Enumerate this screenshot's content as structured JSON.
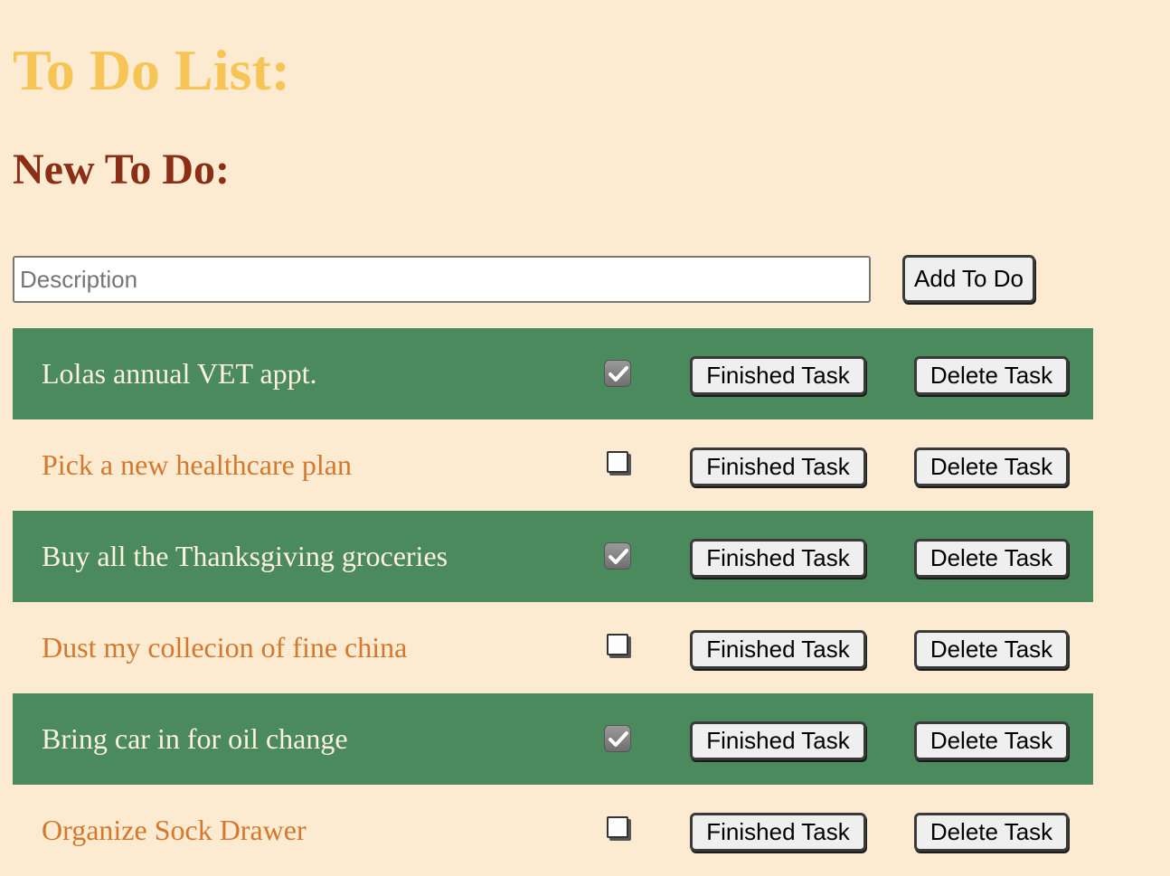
{
  "header": {
    "title": "To Do List:",
    "subtitle": "New To Do:"
  },
  "form": {
    "description_placeholder": "Description",
    "description_value": "",
    "add_label": "Add To Do"
  },
  "todos": [
    {
      "text": "Lolas annual VET appt.",
      "done": true,
      "finish_label": "Finished Task",
      "delete_label": "Delete Task"
    },
    {
      "text": "Pick a new healthcare plan",
      "done": false,
      "finish_label": "Finished Task",
      "delete_label": "Delete Task"
    },
    {
      "text": "Buy all the Thanksgiving groceries",
      "done": true,
      "finish_label": "Finished Task",
      "delete_label": "Delete Task"
    },
    {
      "text": "Dust my collecion of fine china",
      "done": false,
      "finish_label": "Finished Task",
      "delete_label": "Delete Task"
    },
    {
      "text": "Bring car in for oil change",
      "done": true,
      "finish_label": "Finished Task",
      "delete_label": "Delete Task"
    },
    {
      "text": "Organize Sock Drawer",
      "done": false,
      "finish_label": "Finished Task",
      "delete_label": "Delete Task"
    }
  ],
  "colors": {
    "background": "#fcebd0",
    "title": "#f6c556",
    "subtitle": "#8a2e15",
    "done_row": "#4a8a5d",
    "done_text": "#fdf3dc",
    "pending_text": "#d4782e"
  }
}
